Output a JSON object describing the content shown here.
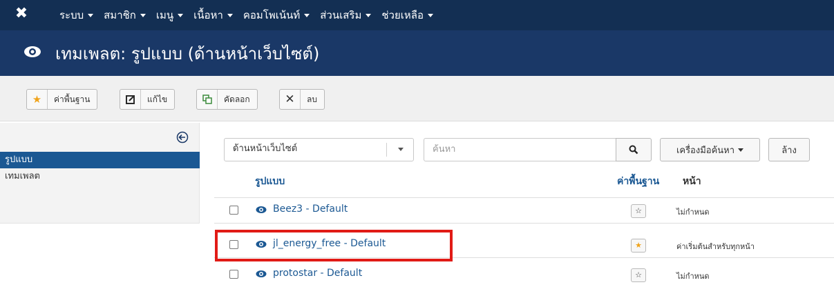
{
  "topnav": {
    "logo_icon": "joomla-logo-icon",
    "items": [
      {
        "label": "ระบบ"
      },
      {
        "label": "สมาชิก"
      },
      {
        "label": "เมนู"
      },
      {
        "label": "เนื้อหา"
      },
      {
        "label": "คอมโพเน้นท์"
      },
      {
        "label": "ส่วนเสริม"
      },
      {
        "label": "ช่วยเหลือ"
      }
    ]
  },
  "header": {
    "icon": "eye-icon",
    "title": "เทมเพลต: รูปแบบ (ด้านหน้าเว็บไซต์)"
  },
  "toolbar": {
    "default_label": "ค่าพื้นฐาน",
    "edit_label": "แก้ไข",
    "copy_label": "คัดลอก",
    "delete_label": "ลบ"
  },
  "sidebar": {
    "items": [
      {
        "label": "รูปแบบ",
        "active": true
      },
      {
        "label": "เทมเพลต",
        "active": false
      }
    ]
  },
  "filters": {
    "location_value": "ด้านหน้าเว็บไซต์",
    "search_placeholder": "ค้นหา",
    "search_tools_label": "เครื่องมือค้นหา",
    "clear_label": "ล้าง"
  },
  "table": {
    "headers": {
      "style": "รูปแบบ",
      "default": "ค่าพื้นฐาน",
      "pages": "หน้า"
    },
    "rows": [
      {
        "name": "Beez3 - Default",
        "is_default": false,
        "pages": "ไม่กำหนด"
      },
      {
        "name": "jl_energy_free - Default",
        "is_default": true,
        "pages": "ค่าเริ่มต้นสำหรับทุกหน้า"
      },
      {
        "name": "protostar - Default",
        "is_default": false,
        "pages": "ไม่กำหนด"
      }
    ]
  },
  "colors": {
    "navbar": "#132f53",
    "header": "#1a3867",
    "link": "#1b5893",
    "active_nav": "#1b5893",
    "highlight": "#e11b16",
    "star_on": "#f0a31a"
  }
}
